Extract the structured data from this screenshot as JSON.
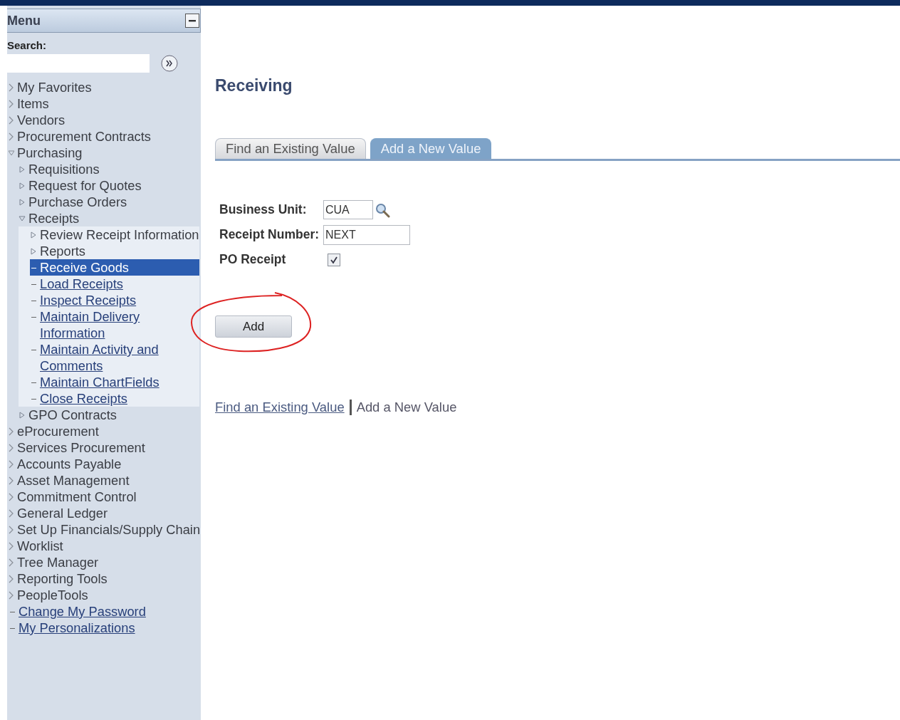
{
  "menu": {
    "title": "Menu",
    "search_label": "Search:",
    "items": [
      {
        "label": "My Favorites",
        "kind": "folder",
        "expanded": false,
        "selected": false
      },
      {
        "label": "Items",
        "kind": "folder",
        "expanded": false,
        "selected": false
      },
      {
        "label": "Vendors",
        "kind": "folder",
        "expanded": false,
        "selected": false
      },
      {
        "label": "Procurement Contracts",
        "kind": "folder",
        "expanded": false,
        "selected": false
      },
      {
        "label": "Purchasing",
        "kind": "folder",
        "expanded": true,
        "selected": false,
        "children": [
          {
            "label": "Requisitions",
            "kind": "folder",
            "expanded": false,
            "selected": false
          },
          {
            "label": "Request for Quotes",
            "kind": "folder",
            "expanded": false,
            "selected": false
          },
          {
            "label": "Purchase Orders",
            "kind": "folder",
            "expanded": false,
            "selected": false
          },
          {
            "label": "Receipts",
            "kind": "folder",
            "expanded": true,
            "selected": false,
            "children": [
              {
                "label": "Review Receipt Information",
                "kind": "folder",
                "expanded": false,
                "selected": false
              },
              {
                "label": "Reports",
                "kind": "folder",
                "expanded": false,
                "selected": false
              },
              {
                "label": "Receive Goods",
                "kind": "link",
                "selected": true
              },
              {
                "label": "Load Receipts",
                "kind": "link",
                "selected": false
              },
              {
                "label": "Inspect Receipts",
                "kind": "link",
                "selected": false
              },
              {
                "label": "Maintain Delivery Information",
                "kind": "link",
                "selected": false
              },
              {
                "label": "Maintain Activity and Comments",
                "kind": "link",
                "selected": false
              },
              {
                "label": "Maintain ChartFields",
                "kind": "link",
                "selected": false
              },
              {
                "label": "Close Receipts",
                "kind": "link",
                "selected": false
              }
            ]
          },
          {
            "label": "GPO Contracts",
            "kind": "folder",
            "expanded": false,
            "selected": false
          }
        ]
      },
      {
        "label": "eProcurement",
        "kind": "folder",
        "expanded": false,
        "selected": false
      },
      {
        "label": "Services Procurement",
        "kind": "folder",
        "expanded": false,
        "selected": false
      },
      {
        "label": "Accounts Payable",
        "kind": "folder",
        "expanded": false,
        "selected": false
      },
      {
        "label": "Asset Management",
        "kind": "folder",
        "expanded": false,
        "selected": false
      },
      {
        "label": "Commitment Control",
        "kind": "folder",
        "expanded": false,
        "selected": false
      },
      {
        "label": "General Ledger",
        "kind": "folder",
        "expanded": false,
        "selected": false
      },
      {
        "label": "Set Up Financials/Supply Chain",
        "kind": "folder",
        "expanded": false,
        "selected": false
      },
      {
        "label": "Worklist",
        "kind": "folder",
        "expanded": false,
        "selected": false
      },
      {
        "label": "Tree Manager",
        "kind": "folder",
        "expanded": false,
        "selected": false
      },
      {
        "label": "Reporting Tools",
        "kind": "folder",
        "expanded": false,
        "selected": false
      },
      {
        "label": "PeopleTools",
        "kind": "folder",
        "expanded": false,
        "selected": false
      },
      {
        "label": "Change My Password",
        "kind": "link",
        "selected": false
      },
      {
        "label": "My Personalizations",
        "kind": "link",
        "selected": false
      }
    ]
  },
  "page": {
    "title": "Receiving",
    "tabs": [
      {
        "label": "Find an Existing Value",
        "selected": false
      },
      {
        "label": "Add a New Value",
        "selected": true
      }
    ],
    "fields": [
      {
        "label": "Business Unit:",
        "kind": "lookup",
        "value": "CUA"
      },
      {
        "label": "Receipt Number:",
        "kind": "text",
        "value": "NEXT"
      },
      {
        "label": "PO Receipt",
        "kind": "checkbox",
        "checked": true
      }
    ],
    "add_button": "Add",
    "footer_links": [
      {
        "label": "Find an Existing Value",
        "selected": false
      },
      {
        "label": "Add a New Value",
        "selected": true
      }
    ]
  }
}
